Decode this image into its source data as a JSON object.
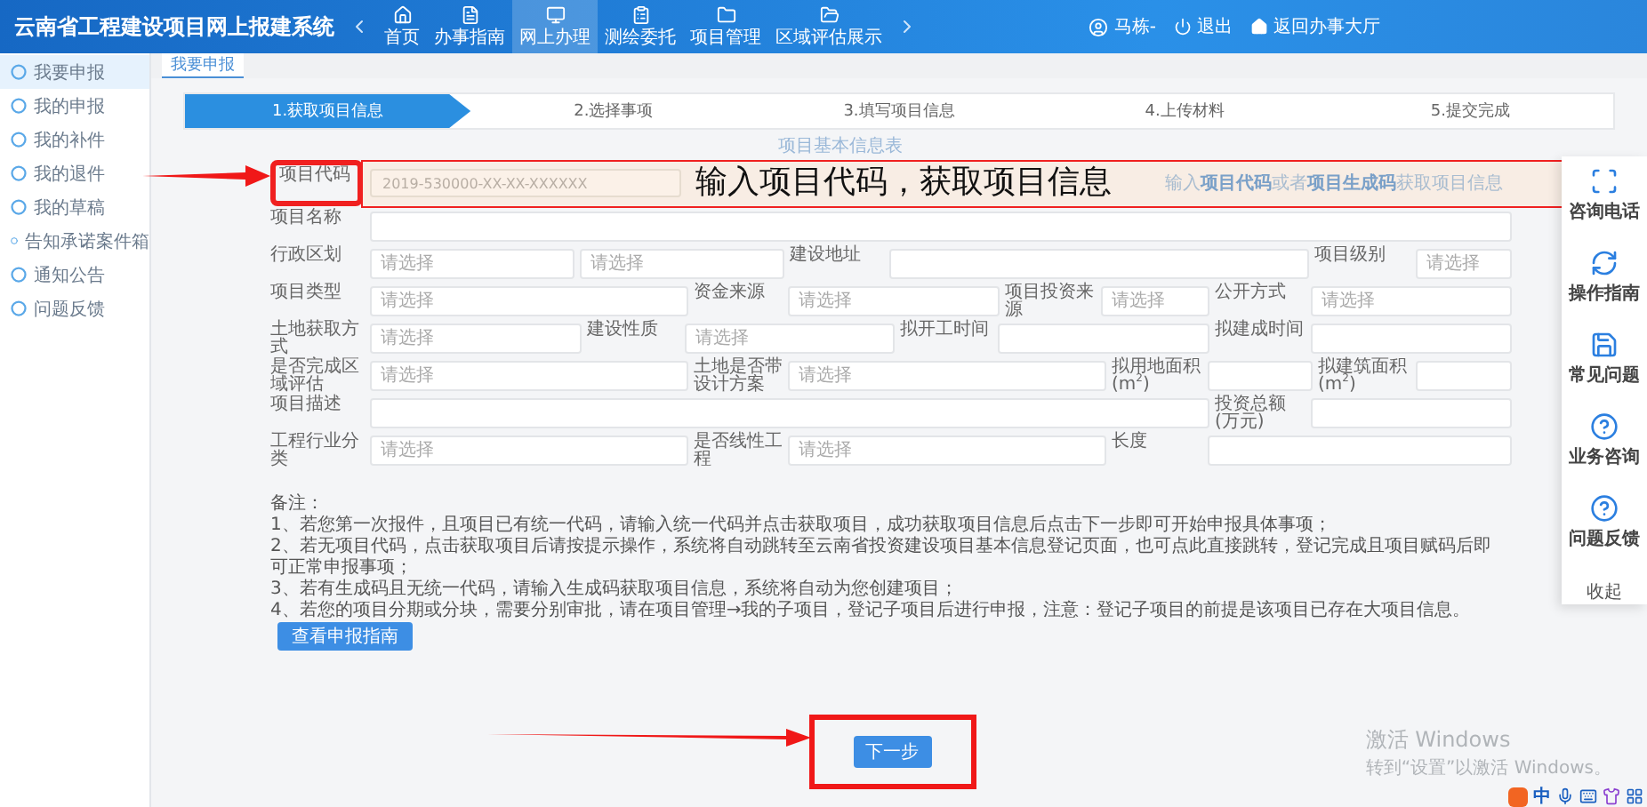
{
  "header": {
    "title": "云南省工程建设项目网上报建系统",
    "nav": [
      {
        "label": "首页",
        "selected": false
      },
      {
        "label": "办事指南",
        "selected": false
      },
      {
        "label": "网上办理",
        "selected": true
      },
      {
        "label": "测绘委托",
        "selected": false
      },
      {
        "label": "项目管理",
        "selected": false
      },
      {
        "label": "区域评估展示",
        "selected": false
      }
    ],
    "user": "马栋-",
    "logout": "退出",
    "back": "返回办事大厅"
  },
  "sidebar": {
    "items": [
      {
        "label": "我要申报",
        "selected": true
      },
      {
        "label": "我的申报",
        "selected": false
      },
      {
        "label": "我的补件",
        "selected": false
      },
      {
        "label": "我的退件",
        "selected": false
      },
      {
        "label": "我的草稿",
        "selected": false
      },
      {
        "label": "告知承诺案件箱",
        "selected": false
      },
      {
        "label": "通知公告",
        "selected": false
      },
      {
        "label": "问题反馈",
        "selected": false
      }
    ]
  },
  "tabs": [
    {
      "label": "我要申报",
      "selected": true
    }
  ],
  "steps": [
    {
      "label": "1.获取项目信息",
      "selected": true
    },
    {
      "label": "2.选择事项",
      "selected": false
    },
    {
      "label": "3.填写项目信息",
      "selected": false
    },
    {
      "label": "4.上传材料",
      "selected": false
    },
    {
      "label": "5.提交完成",
      "selected": false
    }
  ],
  "form": {
    "title": "项目基本信息表",
    "code": {
      "label": "项目代码",
      "placeholder": "2019-530000-XX-XX-XXXXXX",
      "hint": "输入**项目代码**或者**项目生成码**获取项目信息"
    },
    "lines": [
      {
        "fields": [
          {
            "label": "项目名称",
            "inputs": [
              {
                "kind": "input"
              }
            ]
          }
        ]
      },
      {
        "fields": [
          {
            "label": "行政区划",
            "inputs": [
              {
                "kind": "select",
                "placeholder": "请选择"
              },
              {
                "kind": "select",
                "placeholder": "请选择"
              }
            ]
          },
          {
            "label": "建设地址",
            "inputs": [
              {
                "kind": "input"
              }
            ]
          },
          {
            "label": "项目级别",
            "inputs": [
              {
                "kind": "select",
                "placeholder": "请选择"
              }
            ]
          }
        ]
      },
      {
        "fields": [
          {
            "label": "项目类型",
            "inputs": [
              {
                "kind": "select",
                "placeholder": "请选择"
              }
            ]
          },
          {
            "label": "资金来源",
            "inputs": [
              {
                "kind": "select",
                "placeholder": "请选择"
              }
            ]
          },
          {
            "label": "项目投资来源",
            "inputs": [
              {
                "kind": "select",
                "placeholder": "请选择"
              }
            ]
          },
          {
            "label": "公开方式",
            "inputs": [
              {
                "kind": "select",
                "placeholder": "请选择"
              }
            ]
          }
        ]
      },
      {
        "fields": [
          {
            "label": "土地获取方式",
            "inputs": [
              {
                "kind": "select",
                "placeholder": "请选择"
              }
            ]
          },
          {
            "label": "建设性质",
            "inputs": [
              {
                "kind": "select",
                "placeholder": "请选择"
              }
            ]
          },
          {
            "label": "拟开工时间",
            "inputs": [
              {
                "kind": "input"
              }
            ]
          },
          {
            "label": "拟建成时间",
            "inputs": [
              {
                "kind": "input"
              }
            ]
          }
        ]
      },
      {
        "fields": [
          {
            "label": "是否完成区域评估",
            "inputs": [
              {
                "kind": "select",
                "placeholder": "请选择"
              }
            ]
          },
          {
            "label": "土地是否带设计方案",
            "inputs": [
              {
                "kind": "select",
                "placeholder": "请选择"
              }
            ]
          },
          {
            "label": "拟用地面积(m$^{2}$)",
            "inputs": [
              {
                "kind": "input"
              }
            ]
          },
          {
            "label": "拟建筑面积(m$^{2}$)",
            "inputs": [
              {
                "kind": "input"
              }
            ]
          }
        ]
      },
      {
        "fields": [
          {
            "label": "项目描述",
            "inputs": [
              {
                "kind": "input"
              }
            ]
          },
          {
            "label": "投资总额(万元)",
            "inputs": [
              {
                "kind": "input"
              }
            ]
          }
        ]
      },
      {
        "fields": [
          {
            "label": "工程行业分类",
            "inputs": [
              {
                "kind": "select",
                "placeholder": "请选择"
              }
            ]
          },
          {
            "label": "是否线性工程",
            "inputs": [
              {
                "kind": "select",
                "placeholder": "请选择"
              }
            ]
          },
          {
            "label": "长度",
            "inputs": [
              {
                "kind": "input"
              }
            ]
          }
        ]
      }
    ]
  },
  "notes": {
    "title": "备注：",
    "lines": [
      "1、若您第一次报件，且项目已有统一代码，请输入统一代码并点击获取项目，成功获取项目信息后点击下一步即可开始申报具体事项；",
      "2、若无项目代码，点击获取项目后请按提示操作，系统将自动跳转至云南省投资建设项目基本信息登记页面，也可点此直接跳转，登记完成且项目赋码后即可正常申报事项；",
      "3、若有生成码且无统一代码，请输入生成码获取项目信息，系统将自动为您创建项目；",
      "4、若您的项目分期或分块，需要分别审批，请在项目管理→我的子项目，登记子项目后进行申报，注意：登记子项目的前提是该项目已存在大项目信息。"
    ],
    "guide_button": "查看申报指南"
  },
  "next_button": "下一步",
  "callout": "输入项目代码，获取项目信息",
  "side_panel": {
    "items": [
      "咨询电话",
      "操作指南",
      "常见问题",
      "业务咨询",
      "问题反馈"
    ],
    "collapse": "收起"
  },
  "windows_notice": {
    "title": "激活 Windows",
    "text": "转到“设置”以激活 Windows。"
  },
  "taskbar": {
    "ime": "中"
  }
}
